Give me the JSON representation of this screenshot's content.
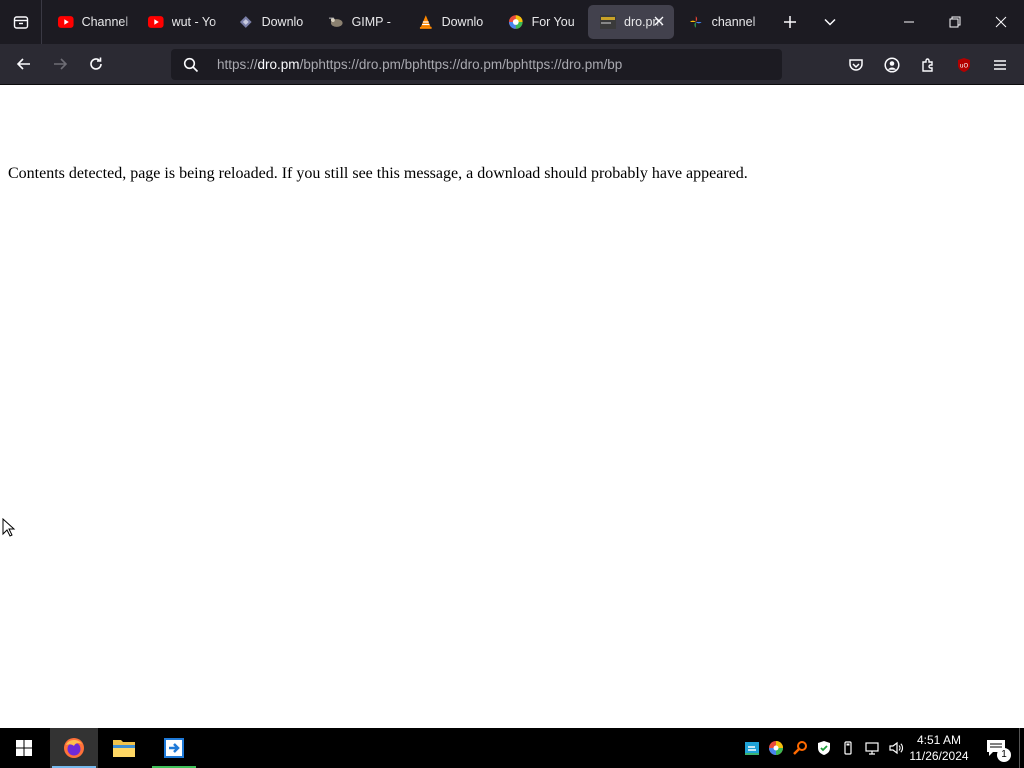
{
  "browser": {
    "tabs": [
      {
        "label": "Channel",
        "icon": "youtube-icon"
      },
      {
        "label": "wut - Yo",
        "icon": "youtube-icon"
      },
      {
        "label": "Downlo",
        "icon": "download-site-icon"
      },
      {
        "label": "GIMP -",
        "icon": "gimp-icon"
      },
      {
        "label": "Downlo",
        "icon": "vlc-icon"
      },
      {
        "label": "For You",
        "icon": "color-wheel-icon"
      },
      {
        "label": "dro.pm",
        "icon": "dropm-icon",
        "active": true
      },
      {
        "label": "channel",
        "icon": "pinwheel-icon"
      }
    ],
    "url": {
      "prefix": "https://",
      "host": "dro.pm",
      "rest": "/bphttps://dro.pm/bphttps://dro.pm/bphttps://dro.pm/bp"
    }
  },
  "page": {
    "message": "Contents detected, page is being reloaded. If you still see this message, a download should probably have appeared."
  },
  "taskbar": {
    "time": "4:51 AM",
    "date": "11/26/2024",
    "notification_count": "1"
  },
  "colors": {
    "tabbar_bg": "#1c1b22",
    "navbar_bg": "#2b2a33",
    "active_tab_bg": "#42414d",
    "youtube_red": "#ff0000",
    "ublock_red": "#b30000"
  }
}
